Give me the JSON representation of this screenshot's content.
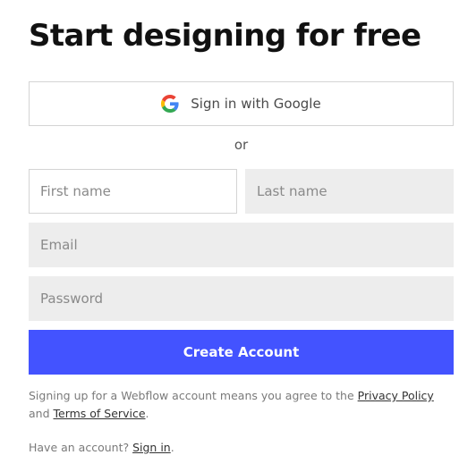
{
  "header": {
    "title": "Start designing for free"
  },
  "google_button": {
    "label": "Sign in with Google",
    "icon": "google-g-icon"
  },
  "divider": {
    "text": "or"
  },
  "form": {
    "first_name": {
      "placeholder": "First name",
      "value": ""
    },
    "last_name": {
      "placeholder": "Last name",
      "value": ""
    },
    "email": {
      "placeholder": "Email",
      "value": ""
    },
    "password": {
      "placeholder": "Password",
      "value": ""
    },
    "submit_label": "Create Account"
  },
  "legal": {
    "prefix": "Signing up for a Webflow account means you agree to the ",
    "privacy_label": "Privacy Policy",
    "and_text": " and ",
    "terms_label": "Terms of Service",
    "suffix": "."
  },
  "signin": {
    "prefix": "Have an account? ",
    "link_label": "Sign in",
    "suffix": "."
  },
  "colors": {
    "accent": "#4353ff",
    "field_bg": "#ededed",
    "border": "#d4d4d4"
  }
}
